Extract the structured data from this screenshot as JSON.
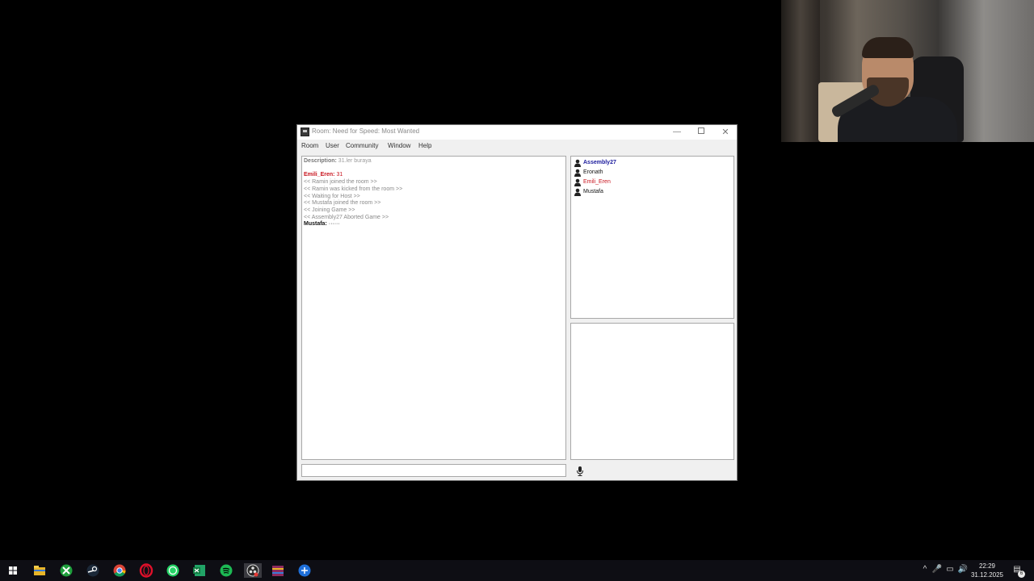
{
  "window": {
    "title": "Room: Need for Speed: Most Wanted"
  },
  "menu": [
    "Room",
    "User",
    "Community",
    "Window",
    "Help"
  ],
  "chat": {
    "description_label": "Description:",
    "description_value": "31.ler buraya",
    "first_message": {
      "user": "Emili_Eren:",
      "text": "31"
    },
    "events": [
      "<< Ramin joined the room >>",
      "<< Ramin was kicked from the room >>",
      "<< Waiting for Host >>",
      "<< Mustafa joined the room >>",
      "<< Joining Game >>",
      "<< Assembly27 Aborted Game >>"
    ],
    "last_message": {
      "user": "Mustafa:",
      "text": "······"
    }
  },
  "users": [
    {
      "name": "Assembly27",
      "color": "#1a1a9c",
      "bold": true
    },
    {
      "name": "Eronath",
      "color": "#111111",
      "bold": false
    },
    {
      "name": "Emili_Eren",
      "color": "#c8141e",
      "bold": false
    },
    {
      "name": "Mustafa",
      "color": "#111111",
      "bold": false
    }
  ],
  "input": {
    "value": "",
    "placeholder": ""
  },
  "taskbar": {
    "apps": [
      "windows-start",
      "file-explorer",
      "xbox",
      "steam",
      "chrome",
      "opera",
      "whatsapp",
      "excel",
      "spotify",
      "obs",
      "winrar",
      "app-blue"
    ],
    "clock_time": "22:29",
    "clock_date": "31.12.2025",
    "notification_count": "6"
  }
}
